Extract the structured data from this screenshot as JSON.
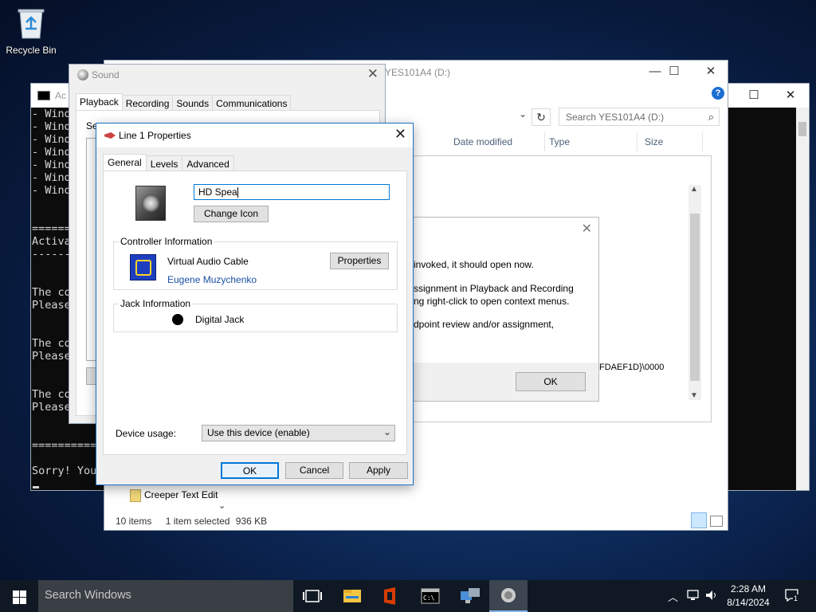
{
  "desktop": {
    "recycle_bin": "Recycle Bin"
  },
  "console": {
    "title": "Ac",
    "lines": [
      "- Wind",
      "- Wind",
      "- Wind",
      "- Wind",
      "- Wind",
      "- Wind",
      "- Wind",
      "",
      "",
      "=======",
      "Activa",
      "------",
      "",
      "",
      "The co",
      "Please",
      "",
      "",
      "The co",
      "Please",
      "",
      "",
      "The co",
      "Please",
      "",
      "",
      "==========",
      "",
      "Sorry! You"
    ]
  },
  "explorer": {
    "title": "YES101A4 (D:)",
    "search_placeholder": "Search YES101A4 (D:)",
    "columns": [
      "Date modified",
      "Type",
      "Size"
    ],
    "file_item": "Creeper Text Edit",
    "status": {
      "count": "10 items",
      "selected": "1 item selected",
      "size": "936 KB"
    }
  },
  "message": {
    "lines": [
      "invoked, it should open now.",
      "ssignment in Playback and Recording",
      "ng right-click to open context menus.",
      "dpoint review and/or assignment,"
    ],
    "guid_tail": "FDAEF1D}\\0000",
    "ok": "OK"
  },
  "sound": {
    "title": "Sound",
    "tabs": [
      "Playback",
      "Recording",
      "Sounds",
      "Communications"
    ],
    "desc": "Se"
  },
  "props": {
    "title": "Line 1 Properties",
    "tabs": [
      "General",
      "Levels",
      "Advanced"
    ],
    "device_name": "HD Spea",
    "change_icon": "Change Icon",
    "controller_legend": "Controller Information",
    "controller_name": "Virtual Audio Cable",
    "controller_vendor": "Eugene Muzychenko",
    "properties_btn": "Properties",
    "jack_legend": "Jack Information",
    "jack_name": "Digital Jack",
    "usage_label": "Device usage:",
    "usage_value": "Use this device (enable)",
    "ok": "OK",
    "cancel": "Cancel",
    "apply": "Apply"
  },
  "taskbar": {
    "search": "Search Windows",
    "time": "2:28 AM",
    "date": "8/14/2024",
    "notif_count": "1"
  }
}
